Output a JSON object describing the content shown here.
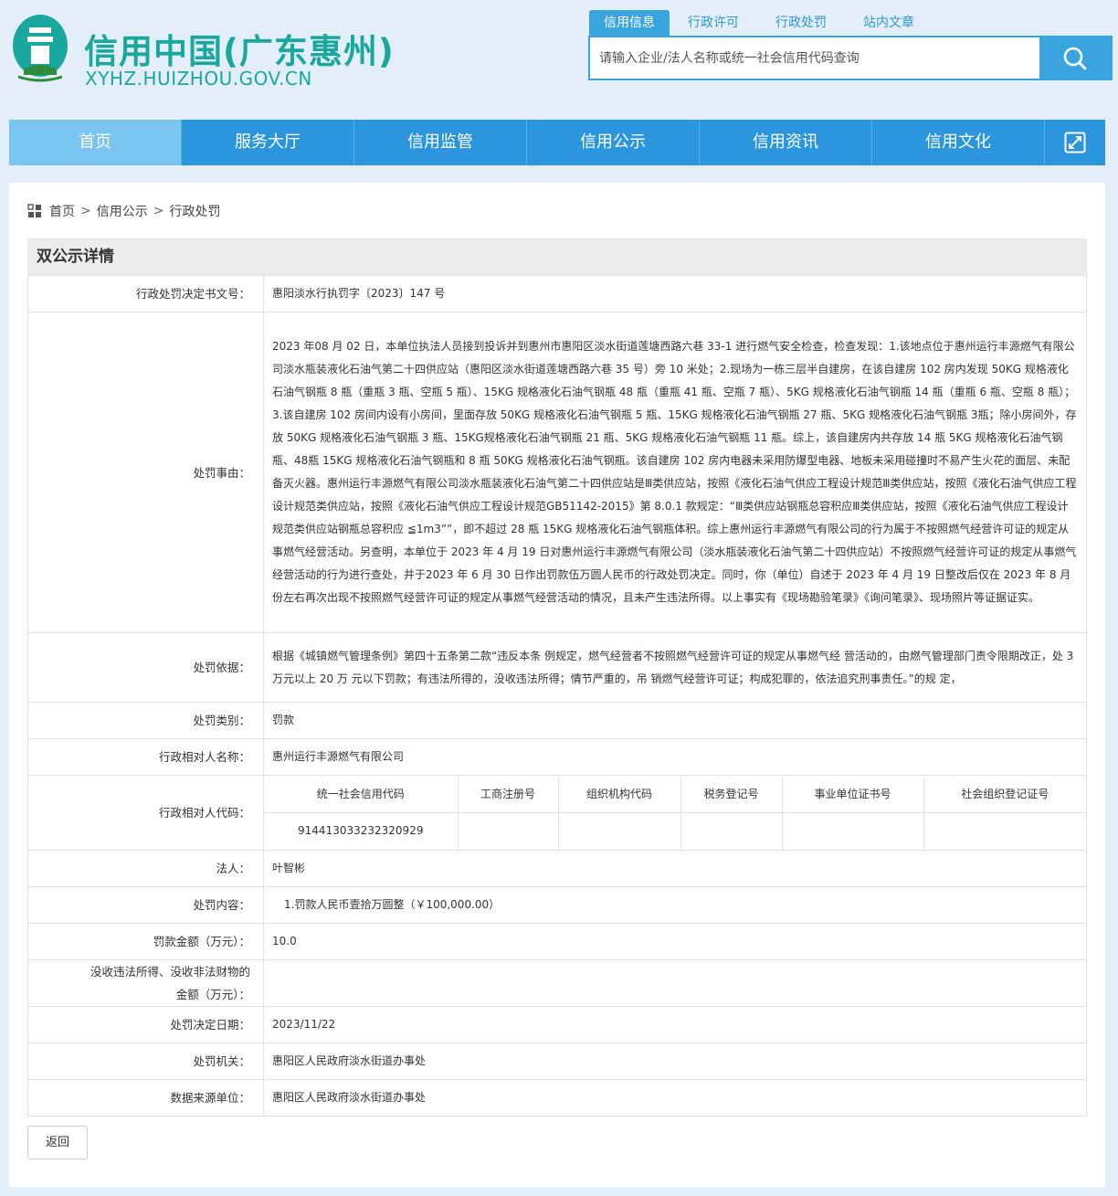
{
  "site": {
    "title": "信用中国(广东惠州)",
    "url": "XYHZ.HUIZHOU.GOV.CN",
    "brand_color": "#1aa89e",
    "accent_color": "#2b96dd"
  },
  "search": {
    "tabs": [
      {
        "label": "信用信息",
        "active": true
      },
      {
        "label": "行政许可",
        "active": false
      },
      {
        "label": "行政处罚",
        "active": false
      },
      {
        "label": "站内文章",
        "active": false
      }
    ],
    "placeholder": "请输入企业/法人名称或统一社会信用代码查询",
    "button_icon": "search-icon"
  },
  "nav": {
    "items": [
      {
        "label": "首页",
        "active": true
      },
      {
        "label": "服务大厅",
        "active": false
      },
      {
        "label": "信用监管",
        "active": false
      },
      {
        "label": "信用公示",
        "active": false
      },
      {
        "label": "信用资讯",
        "active": false
      },
      {
        "label": "信用文化",
        "active": false
      }
    ],
    "expand_icon": "expand-icon"
  },
  "breadcrumb": {
    "icon": "grid-icon",
    "items": [
      "首页",
      "信用公示",
      "行政处罚"
    ],
    "separator": ">"
  },
  "detail": {
    "section_title": "双公示详情",
    "rows": {
      "decision_no": {
        "label": "行政处罚决定书文号：",
        "value": "惠阳淡水行执罚字〔2023〕147 号"
      },
      "reason": {
        "label": "处罚事由：",
        "value": "2023 年08 月 02 日，本单位执法人员接到投诉并到惠州市惠阳区淡水街道莲塘西路六巷 33-1 进行燃气安全检查，检查发现：1.该地点位于惠州运行丰源燃气有限公司淡水瓶装液化石油气第二十四供应站（惠阳区淡水街道莲塘西路六巷 35 号）旁 10 米处；2.现场为一栋三层半自建房，在该自建房 102 房内发现 50KG 规格液化石油气钢瓶 8 瓶（重瓶 3 瓶、空瓶 5 瓶）、15KG 规格液化石油气钢瓶 48 瓶（重瓶 41 瓶、空瓶 7 瓶）、5KG 规格液化石油气钢瓶 14 瓶（重瓶 6 瓶、空瓶 8 瓶）；3.该自建房 102 房间内设有小房间，里面存放 50KG 规格液化石油气钢瓶 5 瓶、15KG 规格液化石油气钢瓶 27 瓶、5KG 规格液化石油气钢瓶 3瓶；除小房间外，存放 50KG 规格液化石油气钢瓶 3 瓶、15KG规格液化石油气钢瓶 21 瓶、5KG 规格液化石油气钢瓶 11 瓶。综上，该自建房内共存放 14 瓶 5KG 规格液化石油气钢瓶、48瓶 15KG 规格液化石油气钢瓶和 8 瓶 50KG 规格液化石油气钢瓶。该自建房 102 房内电器未采用防爆型电器、地板未采用碰撞时不易产生火花的面层、未配备灭火器。惠州运行丰源燃气有限公司淡水瓶装液化石油气第二十四供应站是Ⅲ类供应站，按照《液化石油气供应工程设计规范Ⅲ类供应站，按照《液化石油气供应工程设计规范类供应站，按照《液化石油气供应工程设计规范GB51142-2015》第 8.0.1 款规定：“Ⅲ类供应站钢瓶总容积应Ⅲ类供应站，按照《液化石油气供应工程设计规范类供应站钢瓶总容积应 ≦1m3””，即不超过 28 瓶 15KG 规格液化石油气钢瓶体积。综上惠州运行丰源燃气有限公司的行为属于不按照燃气经营许可证的规定从事燃气经营活动。另查明，本单位于 2023 年 4 月 19 日对惠州运行丰源燃气有限公司（淡水瓶装液化石油气第二十四供应站）不按照燃气经营许可证的规定从事燃气经营活动的行为进行查处，并于2023 年 6 月 30 日作出罚款伍万圆人民币的行政处罚决定。同时，你（单位）自述于 2023 年 4 月 19 日整改后仅在 2023 年 8 月份左右再次出现不按照燃气经营许可证的规定从事燃气经营活动的情况，且未产生违法所得。以上事实有《现场勘验笔录》《询问笔录》、现场照片等证据证实。"
      },
      "basis": {
        "label": "处罚依据：",
        "value": "根据《城镇燃气管理条例》第四十五条第二款“违反本条 例规定，燃气经营者不按照燃气经营许可证的规定从事燃气经 营活动的，由燃气管理部门责令限期改正，处 3 万元以上 20 万 元以下罚款；有违法所得的，没收违法所得；情节严重的，吊 销燃气经营许可证；构成犯罪的，依法追究刑事责任。”的规 定，"
      },
      "category": {
        "label": "处罚类别：",
        "value": "罚款"
      },
      "party_name": {
        "label": "行政相对人名称：",
        "value": "惠州运行丰源燃气有限公司"
      },
      "party_code": {
        "label": "行政相对人代码：",
        "headers": [
          "统一社会信用代码",
          "工商注册号",
          "组织机构代码",
          "税务登记号",
          "事业单位证书号",
          "社会组织登记证号"
        ],
        "values": [
          "914413033232320929",
          "",
          "",
          "",
          "",
          ""
        ]
      },
      "legal_rep": {
        "label": "法人：",
        "value": "叶智彬"
      },
      "content": {
        "label": "处罚内容：",
        "value": "1.罚款人民币壹拾万圆整（￥100,000.00）"
      },
      "fine_amount": {
        "label": "罚款金额（万元）：",
        "value": "10.0"
      },
      "confiscation": {
        "label": "没收违法所得、没收非法财物的金额（万元）：",
        "value": ""
      },
      "decision_date": {
        "label": "处罚决定日期：",
        "value": "2023/11/22"
      },
      "authority": {
        "label": "处罚机关：",
        "value": "惠阳区人民政府淡水街道办事处"
      },
      "data_source": {
        "label": "数据来源单位：",
        "value": "惠阳区人民政府淡水街道办事处"
      }
    }
  },
  "back_button": "返回"
}
